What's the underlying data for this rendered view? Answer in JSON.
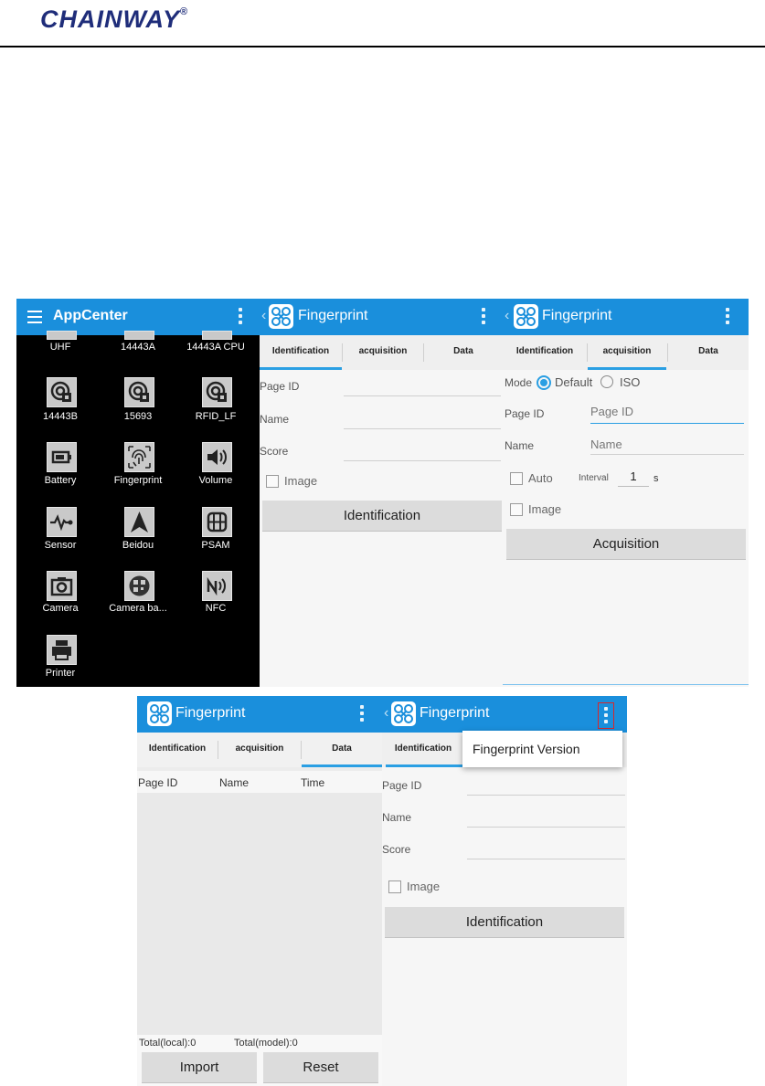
{
  "brand": {
    "logo_text": "CHAINWAY",
    "reg_mark": "®"
  },
  "appcenter": {
    "title": "AppCenter",
    "apps": [
      {
        "label": "UHF",
        "icon": "uhf-icon"
      },
      {
        "label": "14443A",
        "icon": "rfid-icon"
      },
      {
        "label": "14443A CPU",
        "icon": "rfid-icon"
      },
      {
        "label": "14443B",
        "icon": "rfid-icon"
      },
      {
        "label": "15693",
        "icon": "rfid-icon"
      },
      {
        "label": "RFID_LF",
        "icon": "rfid-icon"
      },
      {
        "label": "Battery",
        "icon": "battery-icon"
      },
      {
        "label": "Fingerprint",
        "icon": "fingerprint-icon"
      },
      {
        "label": "Volume",
        "icon": "volume-icon"
      },
      {
        "label": "Sensor",
        "icon": "sensor-icon"
      },
      {
        "label": "Beidou",
        "icon": "navigation-icon"
      },
      {
        "label": "PSAM",
        "icon": "sim-card-icon"
      },
      {
        "label": "Camera",
        "icon": "camera-icon"
      },
      {
        "label": "Camera ba...",
        "icon": "qr-code-icon"
      },
      {
        "label": "NFC",
        "icon": "nfc-icon"
      },
      {
        "label": "Printer",
        "icon": "printer-icon"
      }
    ]
  },
  "fingerprint": {
    "title": "Fingerprint",
    "tabs": [
      "Identification",
      "acquisition",
      "Data"
    ],
    "identification": {
      "page_id_label": "Page ID",
      "name_label": "Name",
      "score_label": "Score",
      "image_label": "Image",
      "button": "Identification"
    },
    "acquisition": {
      "mode_label": "Mode",
      "mode_options": [
        "Default",
        "ISO"
      ],
      "mode_selected": "Default",
      "page_id_label": "Page ID",
      "page_id_placeholder": "Page ID",
      "name_label": "Name",
      "name_placeholder": "Name",
      "auto_label": "Auto",
      "interval_label": "Interval",
      "interval_value": "1",
      "interval_unit": "s",
      "image_label": "Image",
      "button": "Acquisition"
    },
    "data": {
      "columns": [
        "Page ID",
        "Name",
        "Time"
      ],
      "total_local": "Total(local):0",
      "total_model": "Total(model):0",
      "import_button": "Import",
      "reset_button": "Reset"
    },
    "overflow_menu": {
      "item": "Fingerprint Version"
    }
  },
  "colors": {
    "action_bar": "#1a8fdc",
    "tab_indicator": "#2a9fe3",
    "brand": "#1f2d7a"
  }
}
